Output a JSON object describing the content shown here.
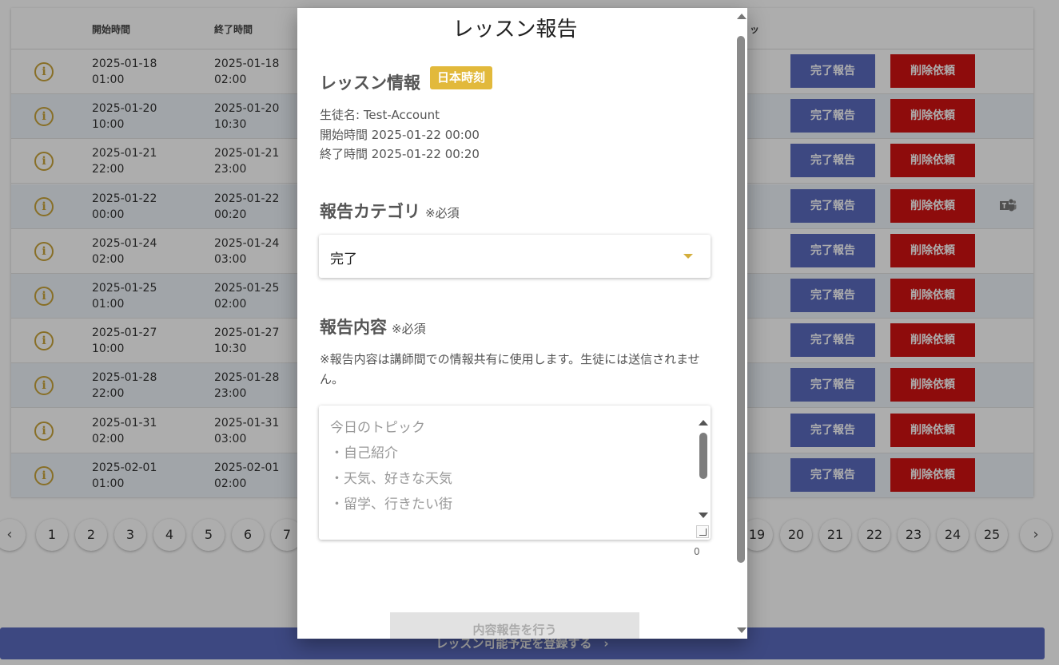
{
  "table": {
    "headers": {
      "start": "開始時間",
      "end": "終了時間",
      "extra": "ッ"
    },
    "rows": [
      {
        "start_date": "2025-01-18",
        "start_time": "01:00",
        "end_date": "2025-01-18",
        "end_time": "02:00"
      },
      {
        "start_date": "2025-01-20",
        "start_time": "10:00",
        "end_date": "2025-01-20",
        "end_time": "10:30"
      },
      {
        "start_date": "2025-01-21",
        "start_time": "22:00",
        "end_date": "2025-01-21",
        "end_time": "23:00"
      },
      {
        "start_date": "2025-01-22",
        "start_time": "00:00",
        "end_date": "2025-01-22",
        "end_time": "00:20"
      },
      {
        "start_date": "2025-01-24",
        "start_time": "02:00",
        "end_date": "2025-01-24",
        "end_time": "03:00"
      },
      {
        "start_date": "2025-01-25",
        "start_time": "01:00",
        "end_date": "2025-01-25",
        "end_time": "02:00"
      },
      {
        "start_date": "2025-01-27",
        "start_time": "10:00",
        "end_date": "2025-01-27",
        "end_time": "10:30"
      },
      {
        "start_date": "2025-01-28",
        "start_time": "22:00",
        "end_date": "2025-01-28",
        "end_time": "23:00"
      },
      {
        "start_date": "2025-01-31",
        "start_time": "02:00",
        "end_date": "2025-01-31",
        "end_time": "03:00"
      },
      {
        "start_date": "2025-02-01",
        "start_time": "01:00",
        "end_date": "2025-02-01",
        "end_time": "02:00"
      }
    ],
    "done_label": "完了報告",
    "delete_label": "削除依頼",
    "info_glyph": "i"
  },
  "pagination": {
    "prev": "‹",
    "next": "›",
    "left_pages": [
      "1",
      "2",
      "3",
      "4",
      "5",
      "6",
      "7"
    ],
    "right_pages": [
      "19",
      "20",
      "21",
      "22",
      "23",
      "24",
      "25"
    ]
  },
  "register_button": "レッスン可能予定を登録する　›",
  "modal": {
    "title": "レッスン報告",
    "lesson_info": {
      "heading": "レッスン情報",
      "badge": "日本時刻",
      "student": "生徒名: Test-Account",
      "start": "開始時間 2025-01-22 00:00",
      "end": "終了時間 2025-01-22 00:20"
    },
    "category": {
      "heading": "報告カテゴリ",
      "required": "※必須",
      "value": "完了"
    },
    "content": {
      "heading": "報告内容",
      "required": "※必須",
      "note": "※報告内容は講師間での情報共有に使用します。生徒には送信されません。",
      "placeholder_lines": [
        "今日のトピック",
        "・自己紹介",
        "・天気、好きな天気",
        "・留学、行きたい街"
      ],
      "counter": "0"
    },
    "submit": "内容報告を行う"
  },
  "colors": {
    "primary": "#5b6bbf",
    "danger": "#d11212",
    "accent": "#e2b93b"
  }
}
